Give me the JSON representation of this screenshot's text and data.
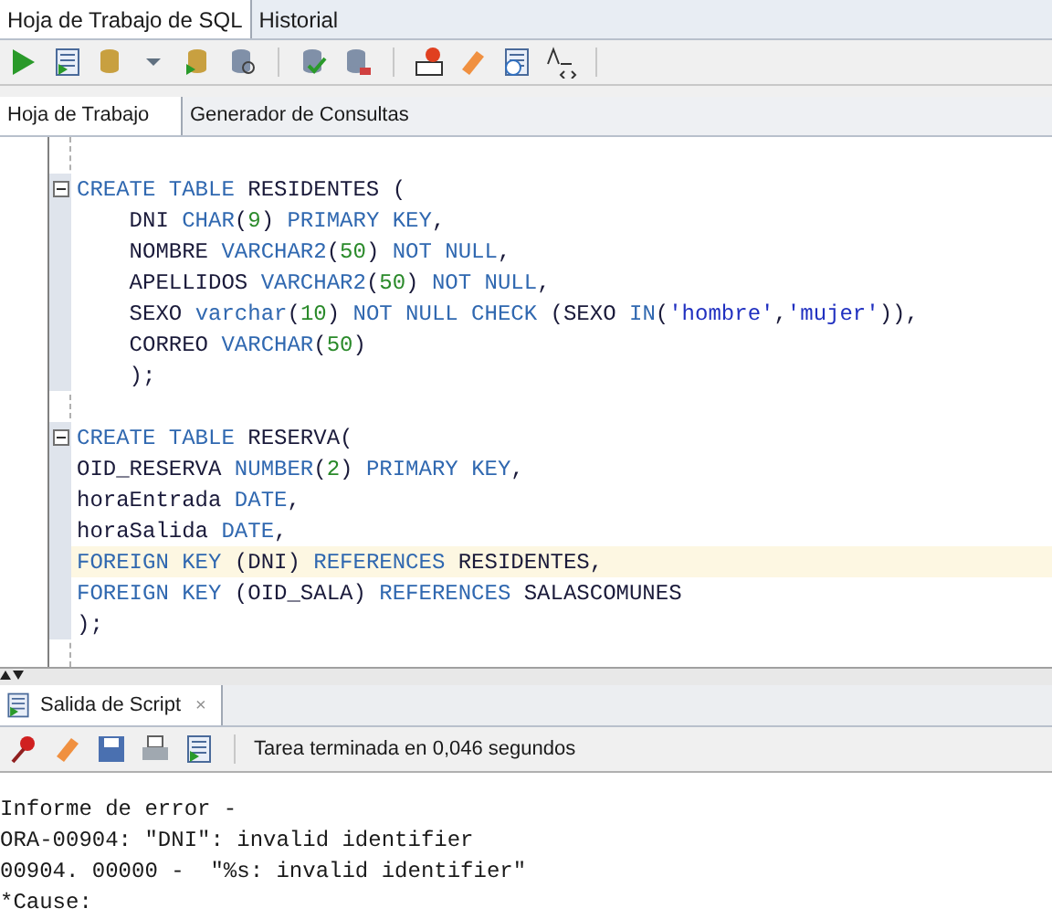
{
  "top_tabs": [
    {
      "label": "Hoja de Trabajo de SQL",
      "selected": true
    },
    {
      "label": "Historial",
      "selected": false
    }
  ],
  "sub_tabs": [
    {
      "label": "Hoja de Trabajo",
      "selected": true
    },
    {
      "label": "Generador de Consultas",
      "selected": false
    }
  ],
  "editor": {
    "lines": [
      {
        "kind": "blank"
      },
      {
        "kind": "code",
        "fold": true,
        "highlighted": false,
        "tokens": [
          {
            "t": "CREATE TABLE",
            "kind": "kw"
          },
          {
            "t": " RESIDENTES (",
            "kind": "id"
          }
        ]
      },
      {
        "kind": "code",
        "fold": false,
        "highlighted": false,
        "tokens": [
          {
            "t": "    DNI ",
            "kind": "id"
          },
          {
            "t": "CHAR",
            "kind": "kw"
          },
          {
            "t": "(",
            "kind": "id"
          },
          {
            "t": "9",
            "kind": "num"
          },
          {
            "t": ") ",
            "kind": "id"
          },
          {
            "t": "PRIMARY KEY",
            "kind": "kw"
          },
          {
            "t": ",",
            "kind": "id"
          }
        ]
      },
      {
        "kind": "code",
        "fold": false,
        "highlighted": false,
        "tokens": [
          {
            "t": "    NOMBRE ",
            "kind": "id"
          },
          {
            "t": "VARCHAR2",
            "kind": "kw"
          },
          {
            "t": "(",
            "kind": "id"
          },
          {
            "t": "50",
            "kind": "num"
          },
          {
            "t": ") ",
            "kind": "id"
          },
          {
            "t": "NOT NULL",
            "kind": "kw"
          },
          {
            "t": ",",
            "kind": "id"
          }
        ]
      },
      {
        "kind": "code",
        "fold": false,
        "highlighted": false,
        "tokens": [
          {
            "t": "    APELLIDOS ",
            "kind": "id"
          },
          {
            "t": "VARCHAR2",
            "kind": "kw"
          },
          {
            "t": "(",
            "kind": "id"
          },
          {
            "t": "50",
            "kind": "num"
          },
          {
            "t": ") ",
            "kind": "id"
          },
          {
            "t": "NOT NULL",
            "kind": "kw"
          },
          {
            "t": ",",
            "kind": "id"
          }
        ]
      },
      {
        "kind": "code",
        "fold": false,
        "highlighted": false,
        "tokens": [
          {
            "t": "    SEXO ",
            "kind": "id"
          },
          {
            "t": "varchar",
            "kind": "kw"
          },
          {
            "t": "(",
            "kind": "id"
          },
          {
            "t": "10",
            "kind": "num"
          },
          {
            "t": ") ",
            "kind": "id"
          },
          {
            "t": "NOT NULL CHECK",
            "kind": "kw"
          },
          {
            "t": " (SEXO ",
            "kind": "id"
          },
          {
            "t": "IN",
            "kind": "kw"
          },
          {
            "t": "(",
            "kind": "id"
          },
          {
            "t": "'hombre'",
            "kind": "str"
          },
          {
            "t": ",",
            "kind": "id"
          },
          {
            "t": "'mujer'",
            "kind": "str"
          },
          {
            "t": ")),",
            "kind": "id"
          }
        ]
      },
      {
        "kind": "code",
        "fold": false,
        "highlighted": false,
        "tokens": [
          {
            "t": "    CORREO ",
            "kind": "id"
          },
          {
            "t": "VARCHAR",
            "kind": "kw"
          },
          {
            "t": "(",
            "kind": "id"
          },
          {
            "t": "50",
            "kind": "num"
          },
          {
            "t": ")",
            "kind": "id"
          }
        ]
      },
      {
        "kind": "code",
        "fold": false,
        "highlighted": false,
        "tokens": [
          {
            "t": "    );",
            "kind": "id"
          }
        ]
      },
      {
        "kind": "blank"
      },
      {
        "kind": "code",
        "fold": true,
        "highlighted": false,
        "tokens": [
          {
            "t": "CREATE TABLE",
            "kind": "kw"
          },
          {
            "t": " RESERVA(",
            "kind": "id"
          }
        ]
      },
      {
        "kind": "code",
        "fold": false,
        "highlighted": false,
        "tokens": [
          {
            "t": "OID_RESERVA ",
            "kind": "id"
          },
          {
            "t": "NUMBER",
            "kind": "kw"
          },
          {
            "t": "(",
            "kind": "id"
          },
          {
            "t": "2",
            "kind": "num"
          },
          {
            "t": ") ",
            "kind": "id"
          },
          {
            "t": "PRIMARY KEY",
            "kind": "kw"
          },
          {
            "t": ",",
            "kind": "id"
          }
        ]
      },
      {
        "kind": "code",
        "fold": false,
        "highlighted": false,
        "tokens": [
          {
            "t": "horaEntrada ",
            "kind": "id"
          },
          {
            "t": "DATE",
            "kind": "kw"
          },
          {
            "t": ",",
            "kind": "id"
          }
        ]
      },
      {
        "kind": "code",
        "fold": false,
        "highlighted": false,
        "tokens": [
          {
            "t": "horaSalida ",
            "kind": "id"
          },
          {
            "t": "DATE",
            "kind": "kw"
          },
          {
            "t": ",",
            "kind": "id"
          }
        ]
      },
      {
        "kind": "code",
        "fold": false,
        "highlighted": true,
        "tokens": [
          {
            "t": "FOREIGN KEY",
            "kind": "kw"
          },
          {
            "t": " (DNI) ",
            "kind": "id"
          },
          {
            "t": "REFERENCES",
            "kind": "kw"
          },
          {
            "t": " RESIDENTES,",
            "kind": "id"
          }
        ]
      },
      {
        "kind": "code",
        "fold": false,
        "highlighted": false,
        "tokens": [
          {
            "t": "FOREIGN KEY",
            "kind": "kw"
          },
          {
            "t": " (OID_SALA) ",
            "kind": "id"
          },
          {
            "t": "REFERENCES",
            "kind": "kw"
          },
          {
            "t": " SALASCOMUNES",
            "kind": "id"
          }
        ]
      },
      {
        "kind": "code",
        "fold": false,
        "highlighted": false,
        "tokens": [
          {
            "t": ");",
            "kind": "id"
          }
        ]
      }
    ]
  },
  "output_tab": {
    "label": "Salida de Script",
    "close": "×"
  },
  "output_status": "Tarea terminada en 0,046 segundos",
  "output_lines": [
    "Informe de error -",
    "ORA-00904: \"DNI\": invalid identifier",
    "00904. 00000 -  \"%s: invalid identifier\"",
    "*Cause:"
  ]
}
